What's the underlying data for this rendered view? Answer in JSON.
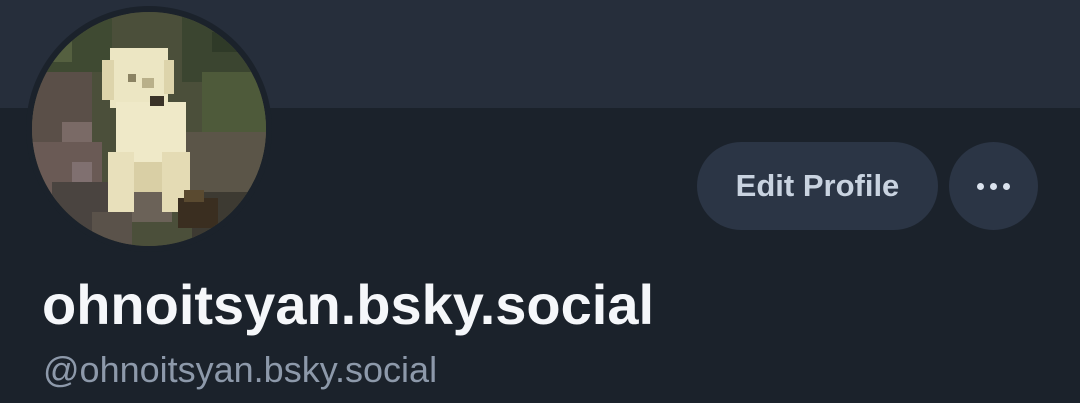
{
  "profile": {
    "display_name": "ohnoitsyan.bsky.social",
    "handle": "@ohnoitsyan.bsky.social",
    "avatar_description": "pixelated white dog"
  },
  "actions": {
    "edit_profile_label": "Edit Profile",
    "more_icon": "ellipsis-icon"
  },
  "colors": {
    "background": "#1b222b",
    "banner": "#262e3b",
    "button_bg": "#2b3545",
    "button_text": "#c9d3e0",
    "name_text": "#f5f7fa",
    "handle_text": "#8d99aa"
  }
}
